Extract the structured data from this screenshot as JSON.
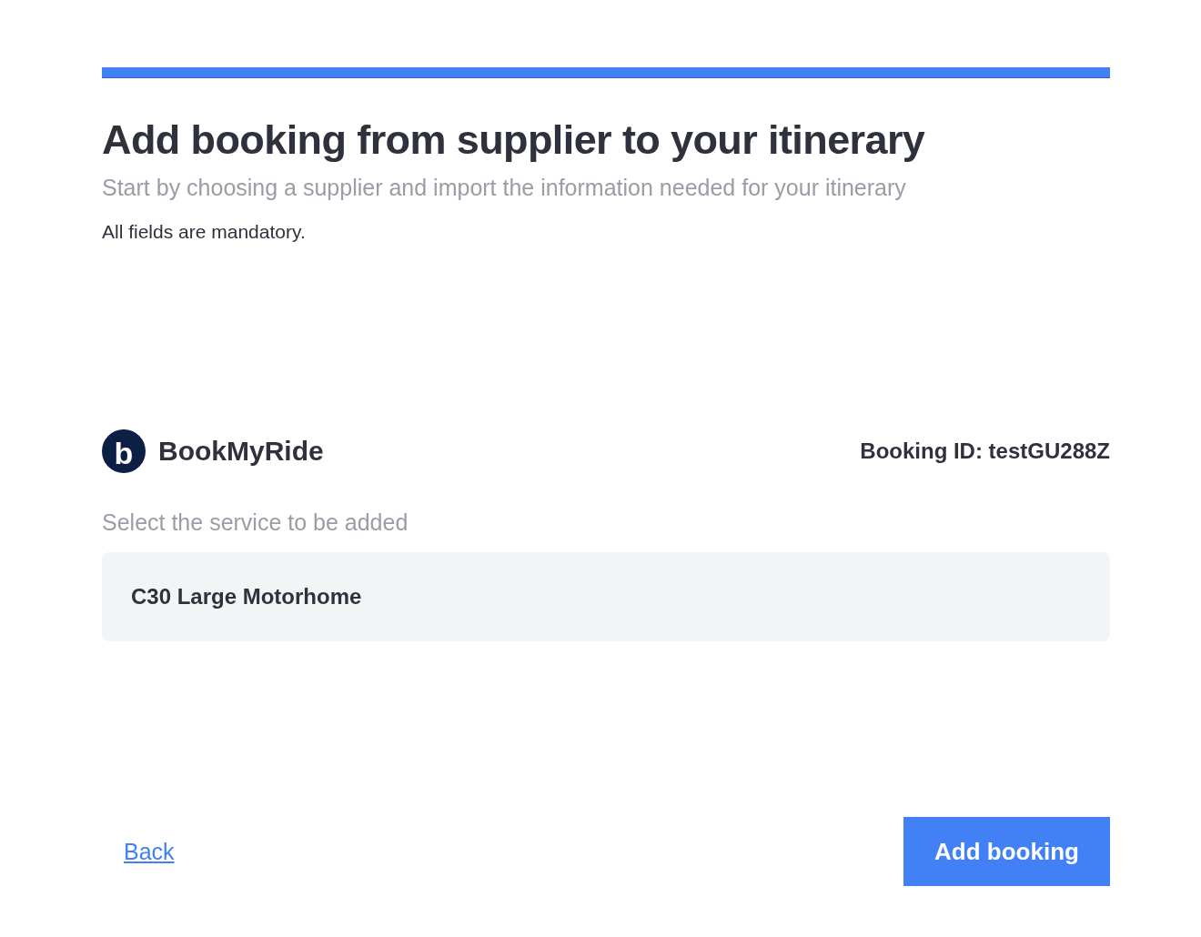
{
  "title": "Add booking from supplier to your itinerary",
  "subtitle": "Start by choosing a supplier and import the information needed for your itinerary",
  "note": "All fields are mandatory.",
  "supplier": {
    "logo_mark": "b",
    "name": "BookMyRide",
    "booking_id": "Booking ID: testGU288Z"
  },
  "service": {
    "label": "Select the service to be added",
    "value": "C30 Large Motorhome"
  },
  "actions": {
    "back": "Back",
    "submit": "Add booking"
  }
}
